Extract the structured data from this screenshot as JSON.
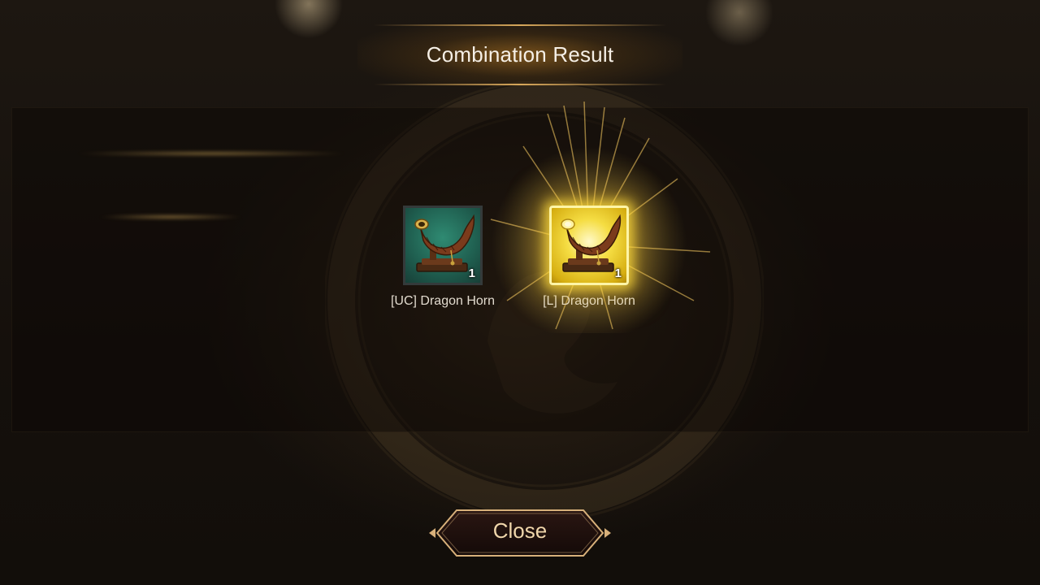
{
  "dialog": {
    "title": "Combination Result"
  },
  "items": [
    {
      "name": "[UC] Dragon Horn",
      "count": "1",
      "rarity": "UC",
      "frame_color": "#1f5e4f"
    },
    {
      "name": "[L] Dragon Horn",
      "count": "1",
      "rarity": "L",
      "frame_color": "#f5dd43"
    }
  ],
  "icons": {
    "item": "dragon-horn-icon"
  },
  "actions": {
    "close_label": "Close"
  },
  "colors": {
    "accent_gold": "#e1af5f",
    "title_text": "#f5efe6",
    "button_text": "#f0d6ab",
    "background": "#15100c"
  }
}
